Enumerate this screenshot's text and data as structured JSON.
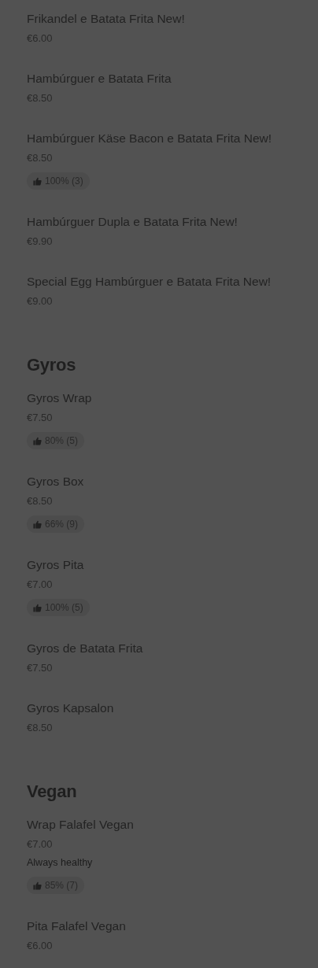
{
  "sections": [
    {
      "items": [
        {
          "name": "Frikandel e Batata Frita New!",
          "price": "€6.00"
        },
        {
          "name": "Hambúrguer e Batata Frita",
          "price": "€8.50"
        },
        {
          "name": "Hambúrguer Käse Bacon e Batata Frita New!",
          "price": "€8.50",
          "rating": "100% (3)"
        },
        {
          "name": "Hambúrguer Dupla e Batata Frita New!",
          "price": "€9.90"
        },
        {
          "name": "Special Egg Hambúrguer e Batata Frita New!",
          "price": "€9.00"
        }
      ]
    },
    {
      "heading": "Gyros",
      "items": [
        {
          "name": "Gyros Wrap",
          "price": "€7.50",
          "rating": "80% (5)"
        },
        {
          "name": "Gyros Box",
          "price": "€8.50",
          "rating": "66% (9)"
        },
        {
          "name": "Gyros Pita",
          "price": "€7.00",
          "rating": "100% (5)"
        },
        {
          "name": "Gyros de Batata Frita",
          "price": "€7.50"
        },
        {
          "name": "Gyros Kapsalon",
          "price": "€8.50"
        }
      ]
    },
    {
      "heading": "Vegan",
      "items": [
        {
          "name": "Wrap Falafel Vegan",
          "price": "€7.00",
          "description": "Always healthy",
          "rating": "85% (7)"
        },
        {
          "name": "Pita Falafel Vegan",
          "price": "€6.00"
        }
      ]
    }
  ]
}
